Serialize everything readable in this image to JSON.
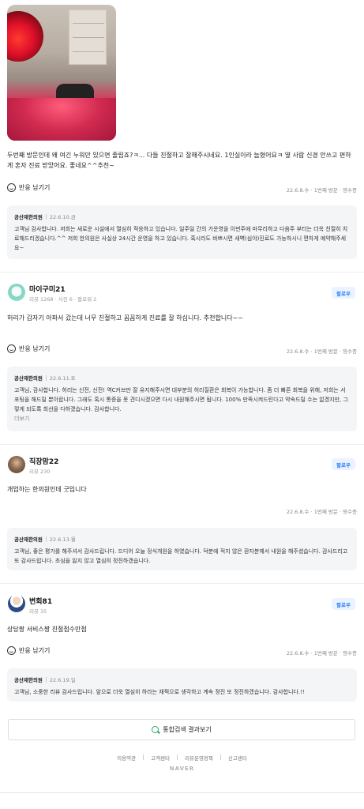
{
  "review1": {
    "text": "두번째 방문인데 왜 여긴 누워만 있으면 졸립죠?ㅋ... 다들 친절하고 잘해주시네요. 1인실이라 눕혔어요ㅋ 옆 사람 신경 안쓰고 편하게 혼자 진료 받았어요. 좋네요^^추천~",
    "react_label": "반응 남기기",
    "meta": "22.6.8.수 · 1번째 방문 · 영수증",
    "reply": {
      "owner": "공산재한의원",
      "date": "22.6.10.금",
      "body": "고객님 감사합니다. 저희는 새로운 시설에서 열심히 적응하고 있습니다. 일주일 간의 가운영을 이번주에 마무리하고 다음주 부터는 더욱 친절히 치료해드리겠습니다.^^ 저희 한의원은 사실상 24시간 운영을 하고 있습니다. 혹시라도 바쁘시면 새벽(심야)진료도 가능하시니 편하게 예약해주세요~"
    }
  },
  "review2": {
    "user": "마이구미21",
    "stats": "리뷰 1268 · 사진 6 · 팔로워 2",
    "follow": "팔로우",
    "text": "허리가 갑자기 아파서 갔는데 너무 친절하고 꼼꼼하게 진료를 잘 하십니다. 추천합니다~~",
    "react_label": "반응 남기기",
    "meta": "22.6.8.수 · 1번째 방문 · 영수증",
    "reply": {
      "owner": "공산재한의원",
      "date": "22.6.11.토",
      "body": "고객님, 감사합니다. 허리는 신전, 신전! 역C커브만 잘 유지해주시면 대부분의 허리질환은 회복이 가능합니다. 좀 더 빠른 회복을 위해, 저희는 서포팅을 해드릴 뿐이랍니다. 그래도 혹시 통증을 못 견디시겠으면 다시 내원해주시면 됩니다. 100% 만족시켜드린다고 약속드릴 수는 없겠지만, 그렇게 되도록 최선을 다하겠습니다. 감사합니다.",
      "more": "더보기"
    }
  },
  "review3": {
    "user": "직장맘22",
    "stats": "리뷰 230",
    "follow": "팔로우",
    "text": "개업하는 한의원인데 굿입니다",
    "meta": "22.6.8.수 · 1번째 방문 · 영수증",
    "reply": {
      "owner": "공산재한의원",
      "date": "22.6.13.월",
      "body": "고객님, 좋은 평가를 해주셔서 감사드립니다. 드디어 오늘 정식개원을 하였습니다. 덕분에 적지 않은 환자분께서 내원을 해주셨습니다. 감사드리고 또 감사드립니다. 초심을 잃지 않고 열심히 정진하겠습니다."
    }
  },
  "review4": {
    "user": "변회81",
    "stats": "리뷰 35",
    "follow": "팔로우",
    "text": "상담짱 서비스짱 친절점수만점",
    "react_label": "반응 남기기",
    "meta": "22.6.8.수 · 1번째 방문 · 영수증",
    "reply": {
      "owner": "공산재한의원",
      "date": "22.6.19.일",
      "body": "고객님, 소중한 리뷰 감사드립니다. 앞으로 더욱 열심히 하라는 채찍으로 생각하고 계속 정진 또 정진하겠습니다. 감사합니다.!!"
    }
  },
  "search_button": "통합검색 결과보기",
  "footer": {
    "links": [
      "이용약관",
      "고객센터",
      "리뷰운영정책",
      "신고센터"
    ],
    "brand": "NAVER"
  },
  "colors": {
    "accent": "#2a7cf6",
    "search_icon": "#2fa76b"
  }
}
